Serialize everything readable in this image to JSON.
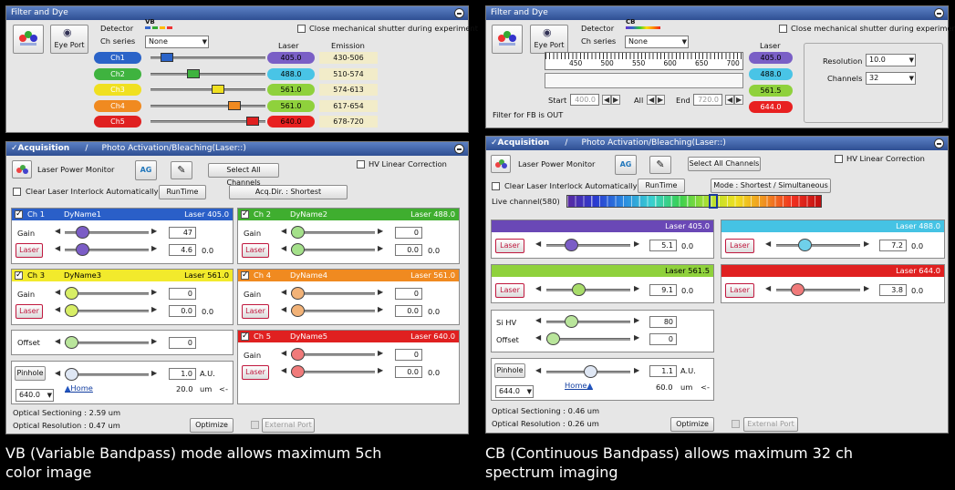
{
  "left": {
    "filter": {
      "title": "Filter and Dye",
      "eye_port": "Eye Port",
      "detector": "Detector",
      "detector_tag": "VB",
      "ch_series": "Ch series",
      "series_value": "None",
      "shutter": "Close mechanical shutter during experiment",
      "laser_hdr": "Laser",
      "emis_hdr": "Emission",
      "channels": [
        {
          "name": "Ch1",
          "laser": "405.0",
          "emission": "430-506",
          "color": "#2a63c8",
          "laser_color": "#7a5fc6",
          "pos": 0.1
        },
        {
          "name": "Ch2",
          "laser": "488.0",
          "emission": "510-574",
          "color": "#3fb33f",
          "laser_color": "#49c4e6",
          "pos": 0.36
        },
        {
          "name": "Ch3",
          "laser": "561.0",
          "emission": "574-613",
          "color": "#f0e020",
          "laser_color": "#8fd13c",
          "pos": 0.6
        },
        {
          "name": "Ch4",
          "laser": "561.0",
          "emission": "617-654",
          "color": "#f08a20",
          "laser_color": "#8fd13c",
          "pos": 0.76
        },
        {
          "name": "Ch5",
          "laser": "640.0",
          "emission": "678-720",
          "color": "#e02020",
          "laser_color": "#e82020",
          "pos": 0.94
        }
      ]
    },
    "acq": {
      "title": "Acquisition",
      "tab2": "Photo Activation/Bleaching(Laser::)",
      "lpm": "Laser Power Monitor",
      "ag": "AG",
      "select_all": "Select All Channels",
      "hv_linear": "HV Linear Correction",
      "clear_interlock": "Clear Laser Interlock Automatically",
      "runtime": "RunTime",
      "acq_dir": "Acq.Dir. : Shortest",
      "ch_boxes": [
        {
          "ch": "Ch 1",
          "dye": "DyName1",
          "laser": "Laser 405.0",
          "color": "#2a5fc8",
          "gain": "47",
          "laser_val": "4.6",
          "laser_zero": "0.0",
          "knob": "#7b5dc6"
        },
        {
          "ch": "Ch 2",
          "dye": "DyName2",
          "laser": "Laser 488.0",
          "color": "#3fae2f",
          "gain": "0",
          "laser_val": "0.0",
          "laser_zero": "0.0",
          "knob": "#a4e08a"
        },
        {
          "ch": "Ch 3",
          "dye": "DyName3",
          "laser": "Laser 561.0",
          "color": "#f2ea2c",
          "gain": "0",
          "laser_val": "0.0",
          "laser_zero": "0.0",
          "knob": "#d8ee66"
        },
        {
          "ch": "Ch 4",
          "dye": "DyName4",
          "laser": "Laser 561.0",
          "color": "#f08a20",
          "gain": "0",
          "laser_val": "0.0",
          "laser_zero": "0.0",
          "knob": "#f2b277"
        },
        {
          "ch": "Ch 5",
          "dye": "DyName5",
          "laser": "Laser 640.0",
          "color": "#e02020",
          "gain": "0",
          "laser_val": "0.0",
          "laser_zero": "0.0",
          "knob": "#f07a7a"
        }
      ],
      "gain_lbl": "Gain",
      "laser_btn": "Laser",
      "offset_lbl": "Offset",
      "offset_val": "0",
      "pinhole": "Pinhole",
      "ph_val": "1.0",
      "au": "A.U.",
      "ph_um": "20.0",
      "um": "um",
      "arrow": "<-",
      "home": "Home",
      "ph_sel": "640.0",
      "opt_sect": "Optical Sectioning : 2.59 um",
      "opt_res": "Optical Resolution : 0.47 um",
      "optimize": "Optimize",
      "ext_port": "External Port"
    }
  },
  "right": {
    "filter": {
      "title": "Filter and Dye",
      "eye_port": "Eye Port",
      "detector": "Detector",
      "detector_tag": "CB",
      "ch_series": "Ch series",
      "series_value": "None",
      "shutter": "Close mechanical shutter during experiment",
      "laser_hdr": "Laser",
      "ticks": [
        "450",
        "500",
        "550",
        "600",
        "650",
        "700"
      ],
      "start_lbl": "Start",
      "start_val": "400.0",
      "all_lbl": "All",
      "end_lbl": "End",
      "end_val": "720.0",
      "fb_out": "Filter for FB is OUT",
      "lasers": [
        {
          "v": "405.0",
          "c": "#7a5fc6"
        },
        {
          "v": "488.0",
          "c": "#49c4e6"
        },
        {
          "v": "561.5",
          "c": "#8fd13c"
        },
        {
          "v": "644.0",
          "c": "#e82020"
        }
      ],
      "resolution_lbl": "Resolution",
      "resolution_val": "10.0",
      "channels_lbl": "Channels",
      "channels_val": "32"
    },
    "acq": {
      "title": "Acquisition",
      "tab2": "Photo Activation/Bleaching(Laser::)",
      "lpm": "Laser Power Monitor",
      "ag": "AG",
      "select_all": "Select All Channels",
      "hv_linear": "HV Linear Correction",
      "clear_interlock": "Clear Laser Interlock Automatically",
      "runtime": "RunTime",
      "mode": "Mode : Shortest / Simultaneous",
      "live": "Live channel(580)",
      "laser_boxes": [
        {
          "laser": "Laser 405.0",
          "color": "#6a48b6",
          "val": "5.1",
          "zero": "0.0",
          "knob": "#7b5dc6",
          "pos": 0.25
        },
        {
          "laser": "Laser 488.0",
          "color": "#45c3e4",
          "val": "7.2",
          "zero": "0.0",
          "knob": "#6fd0ea",
          "pos": 0.3
        },
        {
          "laser": "Laser 561.5",
          "color": "#8fd13c",
          "val": "9.1",
          "zero": "0.0",
          "knob": "#a8dc6a",
          "pos": 0.35
        },
        {
          "laser": "Laser 644.0",
          "color": "#e02020",
          "val": "3.8",
          "zero": "0.0",
          "knob": "#f07a7a",
          "pos": 0.2
        }
      ],
      "laser_btn": "Laser",
      "sihv": "Si HV",
      "sihv_val": "80",
      "offset_lbl": "Offset",
      "offset_val": "0",
      "pinhole": "Pinhole",
      "ph_val": "1.1",
      "au": "A.U.",
      "ph_um": "60.0",
      "um": "um",
      "arrow": "<-",
      "home": "Home",
      "ph_sel": "644.0",
      "opt_sect": "Optical Sectioning : 0.46 um",
      "opt_res": "Optical Resolution : 0.26 um",
      "optimize": "Optimize",
      "ext_port": "External Port"
    }
  },
  "captions": {
    "left": "VB (Variable Bandpass) mode allows maximum 5ch color image",
    "right": "CB (Continuous Bandpass) allows maximum 32 ch spectrum imaging"
  }
}
